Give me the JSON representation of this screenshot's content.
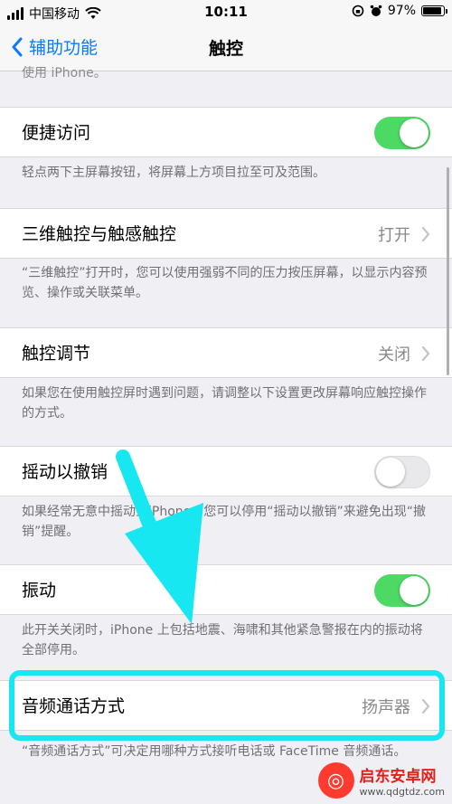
{
  "status_bar": {
    "carrier": "中国移动",
    "time": "10:11",
    "battery": "97%"
  },
  "nav": {
    "back_label": "辅助功能",
    "title": "触控"
  },
  "top_footer": "使用 iPhone。",
  "rows": [
    {
      "label": "便捷访问",
      "type": "toggle",
      "on": true,
      "footer": "轻点两下主屏幕按钮，将屏幕上方项目拉至可及范围。"
    },
    {
      "label": "三维触控与触感触控",
      "type": "link",
      "value": "打开",
      "footer": "“三维触控”打开时，您可以使用强弱不同的压力按压屏幕，以显示内容预览、操作或关联菜单。"
    },
    {
      "label": "触控调节",
      "type": "link",
      "value": "关闭",
      "footer": "如果您在使用触控屏时遇到问题，请调整以下设置更改屏幕响应触控操作的方式。"
    },
    {
      "label": "摇动以撤销",
      "type": "toggle",
      "on": false,
      "footer": "如果经常无意中摇动到iPhone，您可以停用“摇动以撤销”来避免出现“撤销”提醒。"
    },
    {
      "label": "振动",
      "type": "toggle",
      "on": true,
      "footer": "此开关关闭时，iPhone 上包括地震、海啸和其他紧急警报在内的振动将全部停用。"
    },
    {
      "label": "音频通话方式",
      "type": "link",
      "value": "扬声器",
      "footer": "“音频通话方式”可决定用哪种方式接听电话或 FaceTime 音频通话。"
    }
  ],
  "colors": {
    "accent": "#0a7aff",
    "toggle_on": "#4cd964",
    "annotation": "#16e7f0"
  },
  "watermark": {
    "name": "启东安卓网",
    "url": "www.qdgtdz.com"
  }
}
